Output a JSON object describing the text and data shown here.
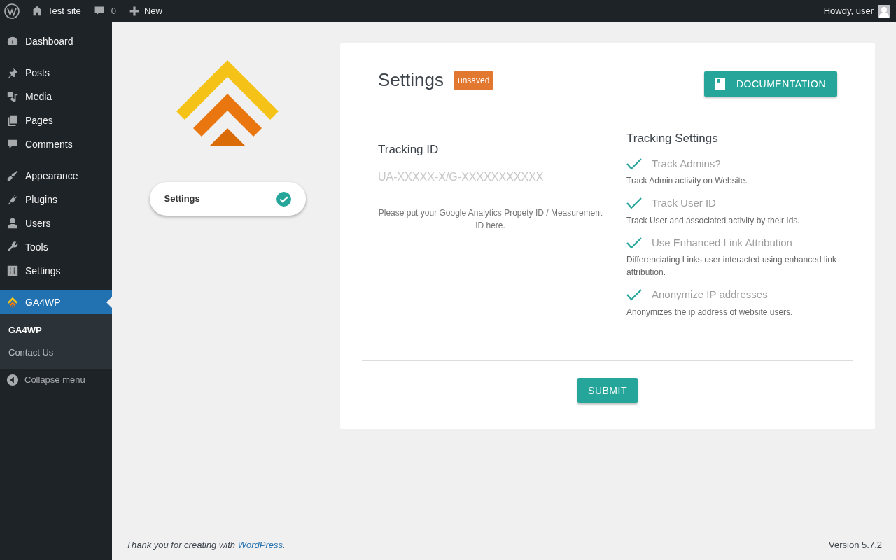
{
  "admin_bar": {
    "site_name": "Test site",
    "comments_count": "0",
    "new_label": "New",
    "greeting": "Howdy, user"
  },
  "sidebar": {
    "groups": [
      {
        "items": [
          {
            "label": "Dashboard",
            "selected": false
          }
        ]
      },
      {
        "items": [
          {
            "label": "Posts",
            "selected": false
          },
          {
            "label": "Media",
            "selected": false
          },
          {
            "label": "Pages",
            "selected": false
          },
          {
            "label": "Comments",
            "selected": false
          }
        ]
      },
      {
        "items": [
          {
            "label": "Appearance",
            "selected": false
          },
          {
            "label": "Plugins",
            "selected": false
          },
          {
            "label": "Users",
            "selected": false
          },
          {
            "label": "Tools",
            "selected": false
          },
          {
            "label": "Settings",
            "selected": false
          }
        ]
      },
      {
        "items": [
          {
            "label": "GA4WP",
            "selected": true
          }
        ]
      }
    ],
    "submenu": [
      {
        "label": "GA4WP",
        "selected": true
      },
      {
        "label": "Contact Us",
        "selected": false
      }
    ],
    "collapse_label": "Collapse menu"
  },
  "plugin_tabs": [
    {
      "label": "Settings",
      "selected": true,
      "completed": true
    }
  ],
  "card": {
    "title": "Settings",
    "badge": "unsaved",
    "doc_button": "DOCUMENTATION",
    "tracking_id": {
      "label": "Tracking ID",
      "placeholder": "UA-XXXXX-X/G-XXXXXXXXXXX",
      "help": "Please put your Google Analytics Propety ID / Measurement ID here."
    },
    "tracking_settings": {
      "title": "Tracking Settings",
      "options": [
        {
          "label": "Track Admins?",
          "description": "Track Admin activity on Website.",
          "checked": true
        },
        {
          "label": "Track User ID",
          "description": "Track User and associated activity by their Ids.",
          "checked": true
        },
        {
          "label": "Use Enhanced Link Attribution",
          "description": "Differenciating Links user interacted using enhanced link attribution.",
          "checked": true
        },
        {
          "label": "Anonymize IP addresses",
          "description": "Anonymizes the ip address of website users.",
          "checked": true
        }
      ]
    },
    "submit": "SUBMIT"
  },
  "footer": {
    "thanks_before": "Thank you for creating with",
    "thanks_link": "WordPress",
    "thanks_after": ".",
    "version": "Version 5.7.2"
  }
}
